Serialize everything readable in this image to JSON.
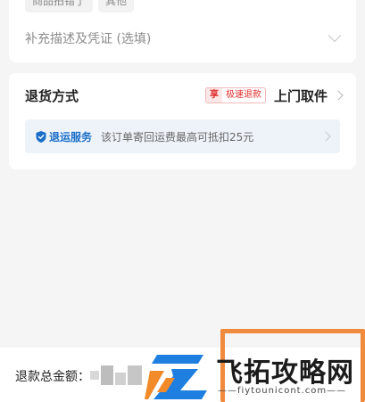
{
  "reason_card": {
    "chips": [
      "商品拍错了",
      "其他"
    ],
    "description_placeholder": "补充描述及凭证 (选填)"
  },
  "return_method": {
    "title": "退货方式",
    "tag_enjoy": "享",
    "tag_fast_refund": "极速退款",
    "method_value": "上门取件"
  },
  "return_service": {
    "name": "退运服务",
    "description": "该订单寄回运费最高可抵扣25元"
  },
  "bottom_bar": {
    "total_label": "退款总金额：",
    "highlight_color": "#f08a3c"
  },
  "watermark": {
    "brand": "飞拓攻略网",
    "url": "——fiytounicont.com——"
  },
  "colors": {
    "accent_blue": "#1b6fc9",
    "accent_red": "#e02e2e",
    "background": "#f5f5f5"
  }
}
